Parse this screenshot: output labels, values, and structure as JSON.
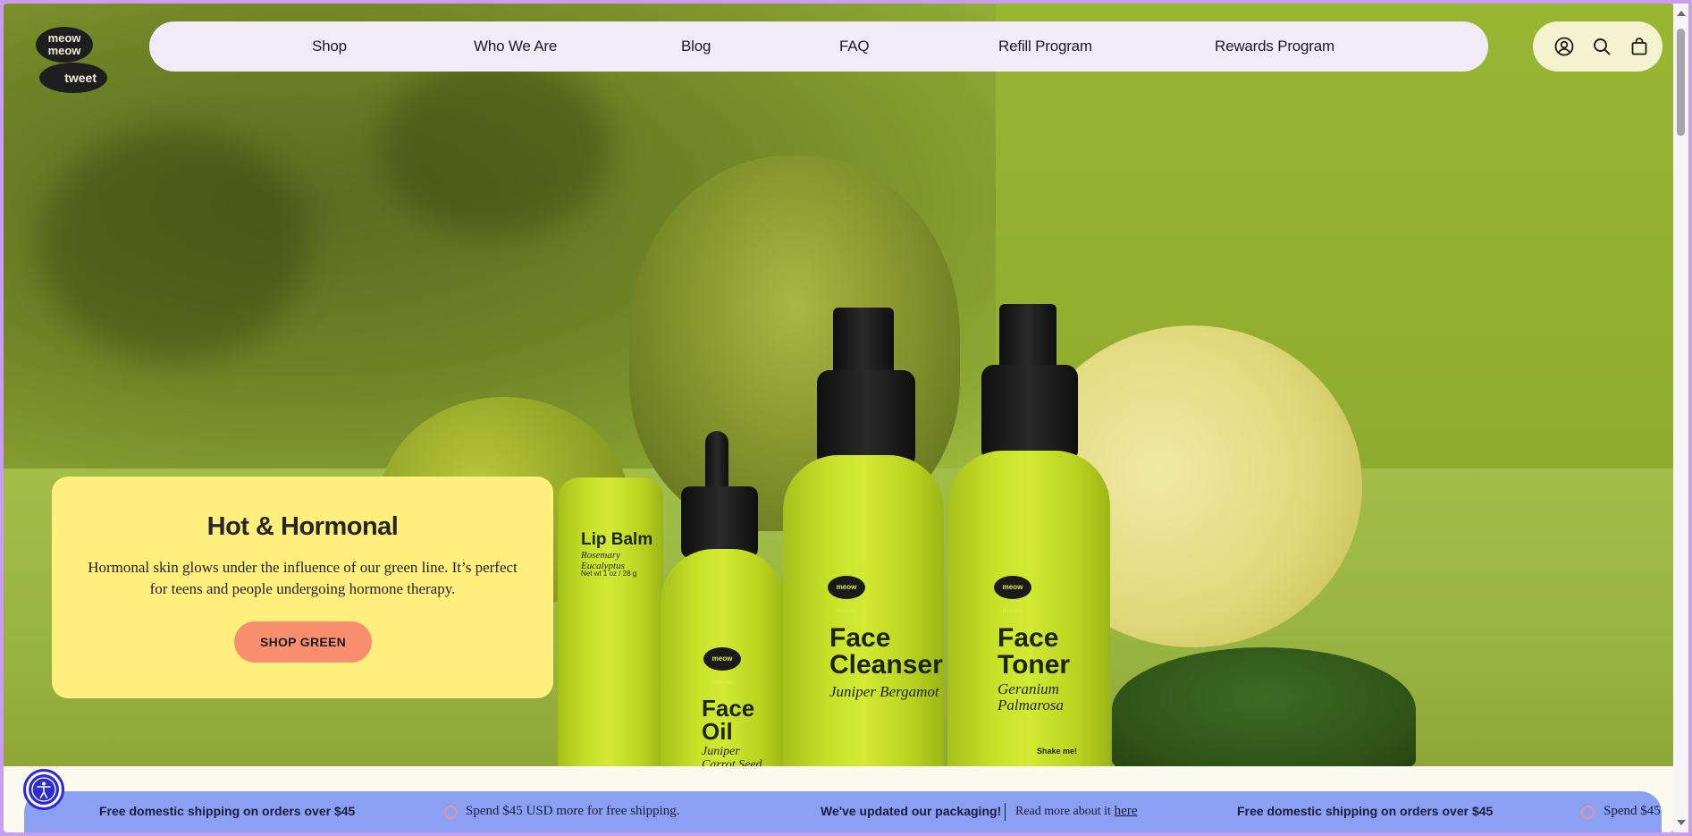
{
  "logo": {
    "line1": "meow meow",
    "line2": "tweet"
  },
  "nav": {
    "items": [
      {
        "label": "Shop"
      },
      {
        "label": "Who We Are"
      },
      {
        "label": "Blog"
      },
      {
        "label": "FAQ"
      },
      {
        "label": "Refill Program"
      },
      {
        "label": "Rewards Program"
      }
    ]
  },
  "header_icons": [
    "account-icon",
    "search-icon",
    "cart-icon"
  ],
  "hero": {
    "products": [
      {
        "name": "Lip Balm",
        "sub": "Rosemary Eucalyptus",
        "size": "Net wt 1 oz / 28 g"
      },
      {
        "name": "Face Oil",
        "sub": "Juniper Carrot Seed"
      },
      {
        "name": "Face Cleanser",
        "sub": "Juniper Bergamot"
      },
      {
        "name": "Face Toner",
        "sub": "Geranium Palmarosa",
        "note": "Shake me!"
      }
    ],
    "badge": "meow meow tweet"
  },
  "promo": {
    "title": "Hot & Hormonal",
    "body": "Hormonal skin glows under the influence of our green line. It’s perfect for teens and people undergoing hormone therapy.",
    "button": "SHOP GREEN"
  },
  "announcement": {
    "msg1": "Free domestic shipping on orders over $45",
    "msg2": "Spend $45 USD more for free shipping.",
    "msg3": "We've updated our packaging!",
    "msg4_prefix": "Read more about it",
    "msg4_link": "here",
    "msg5": "Free domestic shipping on orders over $45",
    "msg6": "Spend $45"
  },
  "colors": {
    "nav_bg": "#efecf8",
    "icons_bg": "#f4f3cf",
    "card_bg": "#fff07e",
    "button_bg": "#fa8f70",
    "announcement_bg": "#8aa1f3",
    "page_border": "#c99ef0"
  }
}
